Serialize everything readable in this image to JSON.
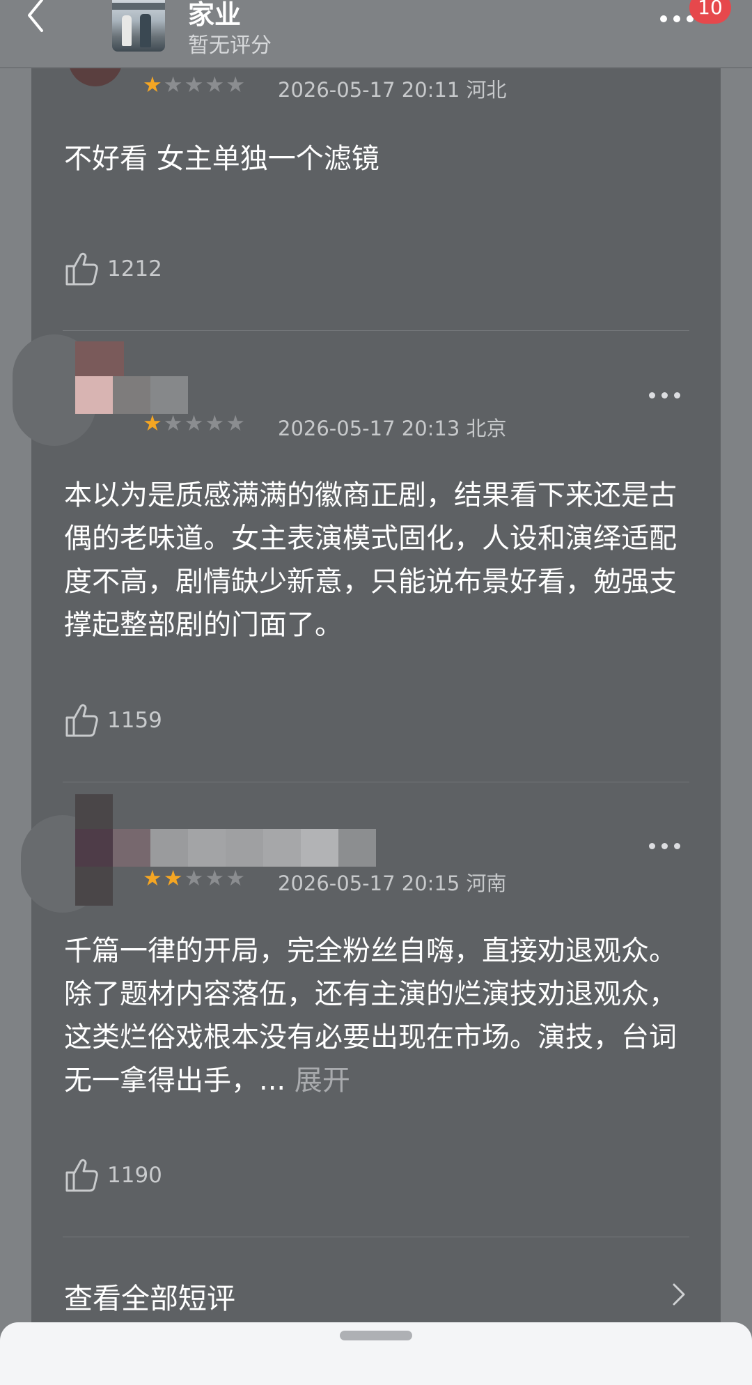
{
  "header": {
    "title": "家业",
    "subtitle": "暂无评分",
    "notification_count": "10"
  },
  "reviews": [
    {
      "rating": 1,
      "max_rating": 5,
      "meta": "2026-05-17 20:11 河北",
      "text": "不好看   女主单独一个滤镜",
      "likes": "1212"
    },
    {
      "rating": 1,
      "max_rating": 5,
      "meta": "2026-05-17 20:13 北京",
      "text": "本以为是质感满满的徽商正剧，结果看下来还是古偶的老味道。女主表演模式固化，人设和演绎适配度不高，剧情缺少新意，只能说布景好看，勉强支撑起整部剧的门面了。",
      "likes": "1159"
    },
    {
      "rating": 2,
      "max_rating": 5,
      "meta": "2026-05-17 20:15 河南",
      "text": "千篇一律的开局，完全粉丝自嗨，直接劝退观众。除了题材内容落伍，还有主演的烂演技劝退观众，这类烂俗戏根本没有必要出现在市场。演技，台词无一拿得出手，...",
      "expand_label": " 展开",
      "likes": "1190"
    }
  ],
  "footer": {
    "view_all_label": "查看全部短评"
  },
  "colors": {
    "background": "#7f8285",
    "card": "#5e6164",
    "star_on": "#f5a623",
    "star_off": "#8b8d90",
    "badge": "#e6484c"
  },
  "icons": {
    "back": "chevron-left-icon",
    "more": "more-dots-icon",
    "like": "thumbs-up-icon",
    "arrow": "chevron-right-icon"
  }
}
